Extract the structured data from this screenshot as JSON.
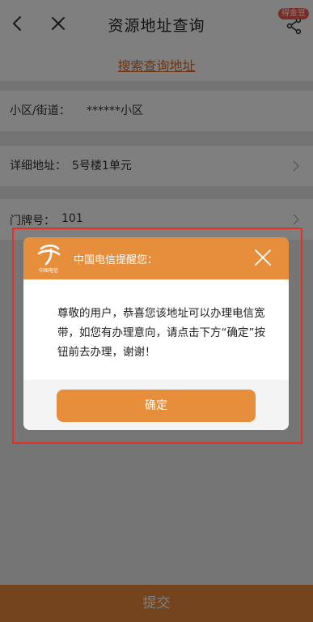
{
  "header": {
    "title": "资源地址查询",
    "badge": "得金豆",
    "back_icon": "chevron-left-icon",
    "close_icon": "close-icon",
    "share_icon": "share-icon"
  },
  "search": {
    "link_label": "搜索查询地址"
  },
  "form": {
    "fields": [
      {
        "label": "小区/街道：",
        "value": "******小区"
      },
      {
        "label": "详细地址：",
        "value": "5号楼1单元"
      },
      {
        "label": "门牌号：",
        "value": "101"
      }
    ]
  },
  "submit": {
    "label": "提交"
  },
  "dialog": {
    "logo_icon": "china-telecom-logo-icon",
    "logo_text": "中国电信",
    "title": "中国电信提醒您：",
    "message": "尊敬的用户，恭喜您该地址可以办理电信宽带，如您有办理意向，请点击下方“确定”按钮前去办理，谢谢！",
    "confirm_label": "确定"
  },
  "colors": {
    "accent": "#e78e3d",
    "link": "#d9691e",
    "highlight_border": "#e5302a",
    "badge": "#f35a4f"
  }
}
